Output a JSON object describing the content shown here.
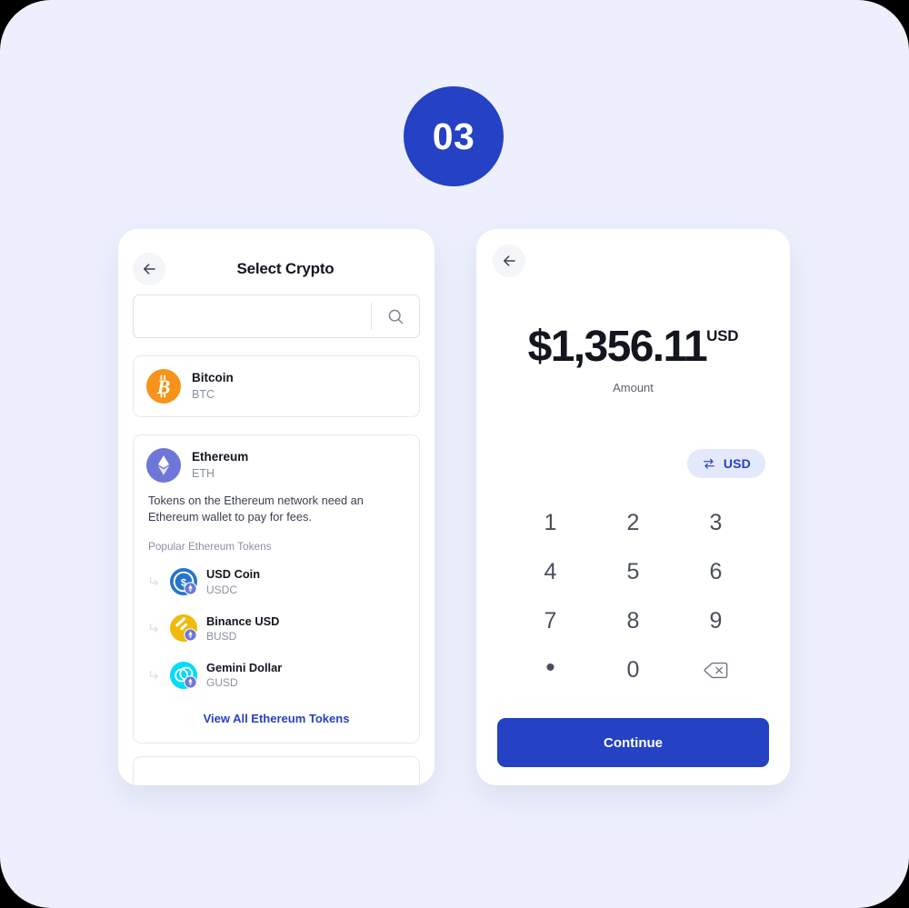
{
  "step": {
    "number": "03"
  },
  "left_screen": {
    "back_icon": "arrow-left-icon",
    "title": "Select Crypto",
    "search": {
      "value": "",
      "placeholder": "",
      "icon": "search-icon"
    },
    "bitcoin": {
      "name": "Bitcoin",
      "symbol": "BTC",
      "icon": "bitcoin-icon",
      "color": "#F7931A"
    },
    "ethereum": {
      "name": "Ethereum",
      "symbol": "ETH",
      "icon": "ethereum-icon",
      "color": "#6E77D8",
      "description": "Tokens on the Ethereum network need an Ethereum wallet to pay for fees.",
      "tokens_label": "Popular Ethereum Tokens",
      "tokens": [
        {
          "name": "USD Coin",
          "symbol": "USDC",
          "icon": "usd-coin-icon",
          "color": "#2775CA"
        },
        {
          "name": "Binance USD",
          "symbol": "BUSD",
          "icon": "binance-usd-icon",
          "color": "#F0B90B"
        },
        {
          "name": "Gemini Dollar",
          "symbol": "GUSD",
          "icon": "gemini-dollar-icon",
          "color": "#00DCFA"
        }
      ],
      "view_all_label": "View All Ethereum Tokens"
    }
  },
  "right_screen": {
    "back_icon": "arrow-left-icon",
    "amount": {
      "value": "$1,356.11",
      "currency_superscript": "USD",
      "label": "Amount"
    },
    "currency_chip": {
      "label": "USD",
      "icon": "swap-icon"
    },
    "keypad": [
      {
        "key": "1",
        "name": "key-1"
      },
      {
        "key": "2",
        "name": "key-2"
      },
      {
        "key": "3",
        "name": "key-3"
      },
      {
        "key": "4",
        "name": "key-4"
      },
      {
        "key": "5",
        "name": "key-5"
      },
      {
        "key": "6",
        "name": "key-6"
      },
      {
        "key": "7",
        "name": "key-7"
      },
      {
        "key": "8",
        "name": "key-8"
      },
      {
        "key": "9",
        "name": "key-9"
      },
      {
        "key": "•",
        "name": "key-decimal"
      },
      {
        "key": "0",
        "name": "key-0"
      },
      {
        "key": "",
        "name": "key-backspace"
      }
    ],
    "continue_label": "Continue"
  },
  "colors": {
    "accent": "#2541C4",
    "background": "#EDF0FC",
    "chip_bg": "#E3E9FB"
  }
}
